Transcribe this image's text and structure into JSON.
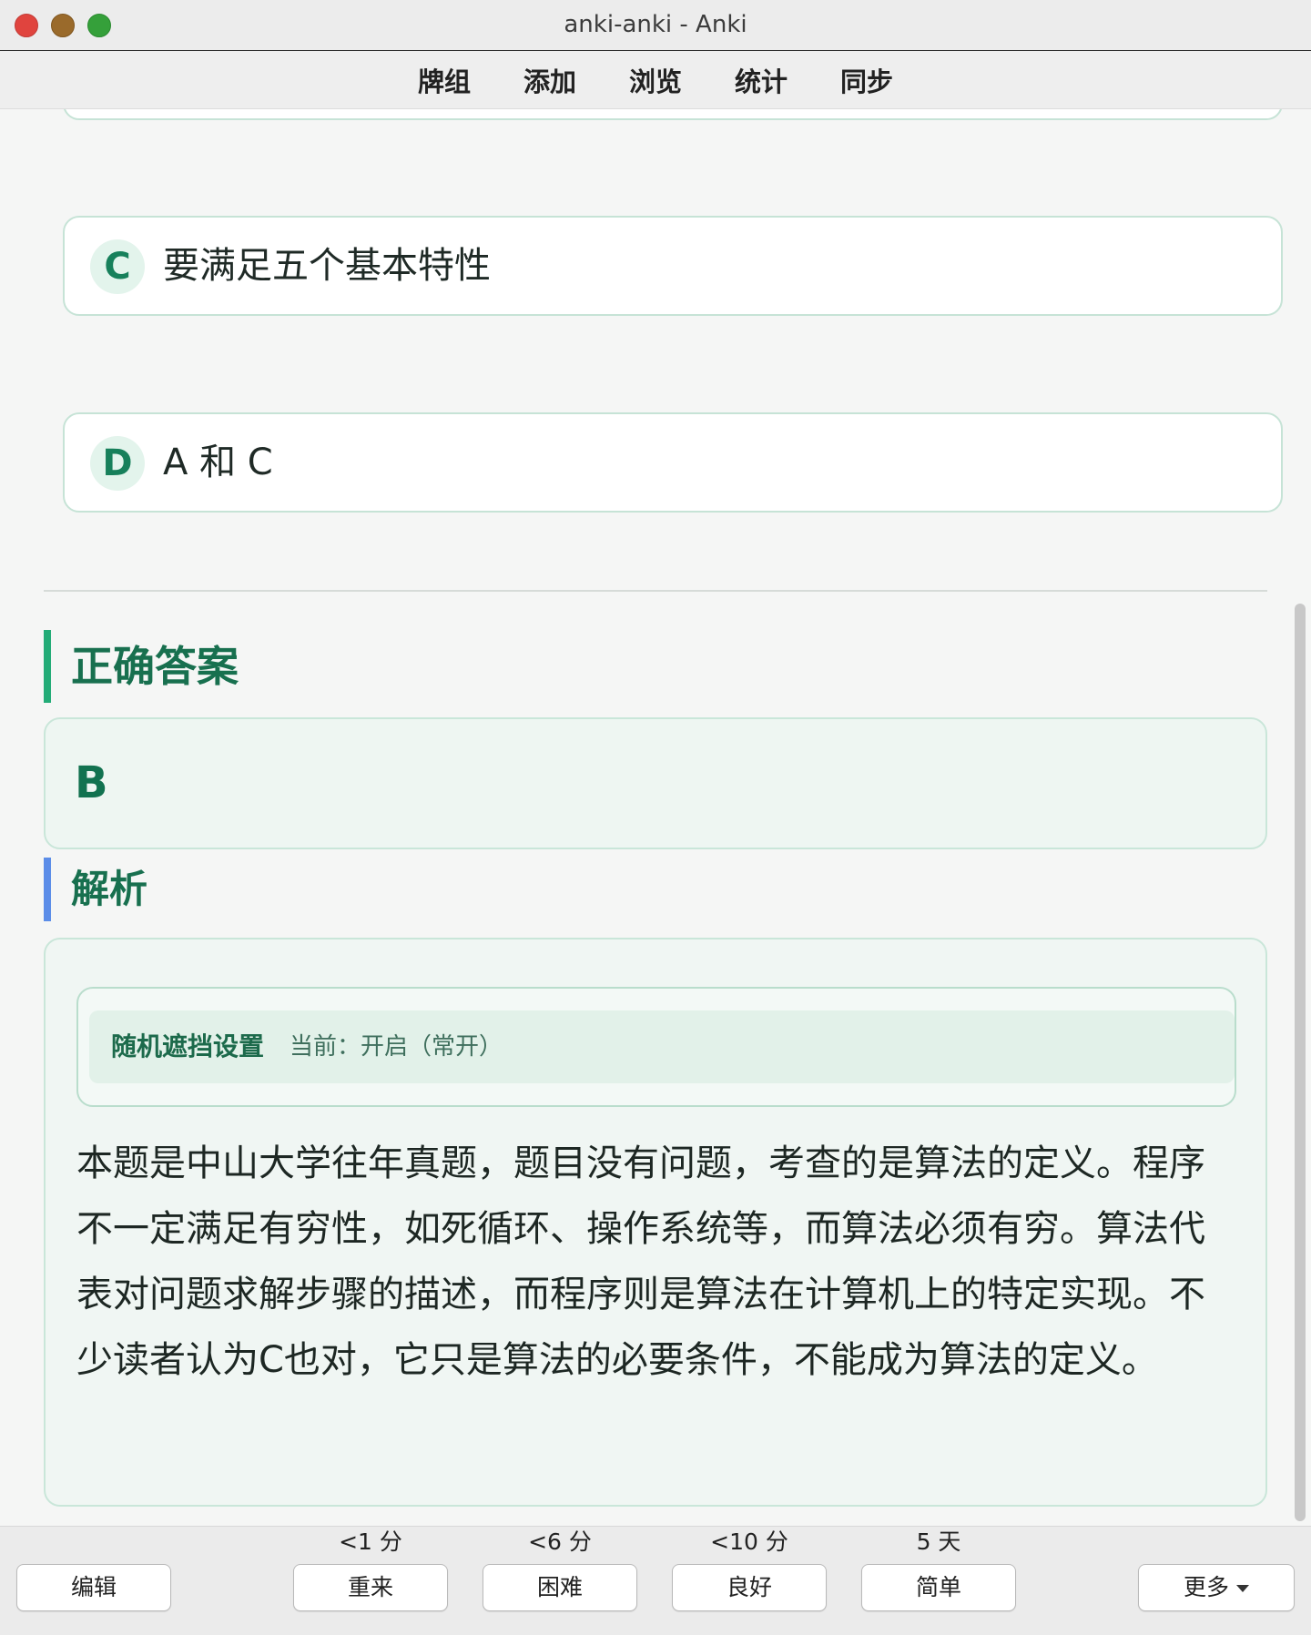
{
  "window": {
    "title": "anki-anki - Anki"
  },
  "toolbar": {
    "items": [
      "牌组",
      "添加",
      "浏览",
      "统计",
      "同步"
    ]
  },
  "options": [
    {
      "letter": "C",
      "text": "要满足五个基本特性"
    },
    {
      "letter": "D",
      "text": "A 和 C"
    }
  ],
  "answer": {
    "heading": "正确答案",
    "value": "B"
  },
  "analysis": {
    "heading": "解析",
    "mask_title": "随机遮挡设置",
    "mask_status": "当前：开启（常开）",
    "text": "本题是中山大学往年真题，题目没有问题，考查的是算法的定义。程序不一定满足有穷性，如死循环、操作系统等，而算法必须有穷。算法代表对问题求解步骤的描述，而程序则是算法在计算机上的特定实现。不少读者认为C也对，它只是算法的必要条件，不能成为算法的定义。"
  },
  "bottom": {
    "edit": "编辑",
    "more": "更多",
    "answers": [
      {
        "interval": "<1 分",
        "label": "重来"
      },
      {
        "interval": "<6 分",
        "label": "困难"
      },
      {
        "interval": "<10 分",
        "label": "良好"
      },
      {
        "interval": "5 天",
        "label": "简单"
      }
    ]
  },
  "colors": {
    "accent_green": "#23ac77",
    "accent_blue": "#5b8de8",
    "heading_green": "#18704f"
  }
}
